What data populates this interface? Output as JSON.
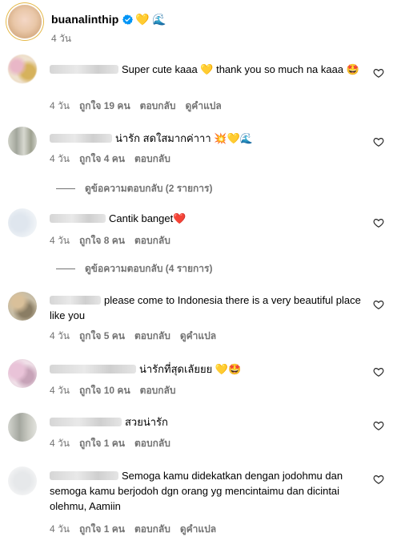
{
  "post": {
    "username": "buanalinthip",
    "emoji_1": "💛",
    "emoji_2": "🌊",
    "time": "4 วัน"
  },
  "labels": {
    "likes_prefix": "ถูกใจ",
    "likes_suffix": "คน",
    "reply": "ตอบกลับ",
    "translate": "ดูคำแปล"
  },
  "comments": [
    {
      "text": "Super cute kaaa 💛 thank you so much na kaaa 🤩",
      "time": "4 วัน",
      "likes": "19",
      "translate": true
    },
    {
      "text": "น่ารัก สดใสมากค่าาา 💥💛🌊",
      "time": "4 วัน",
      "likes": "4",
      "translate": false,
      "view_replies": "ดูข้อความตอบกลับ (2 รายการ)"
    },
    {
      "text": "Cantik banget❤️",
      "time": "4 วัน",
      "likes": "8",
      "translate": false,
      "view_replies": "ดูข้อความตอบกลับ (4 รายการ)"
    },
    {
      "text": "please come to Indonesia there is a very beautiful place like you",
      "time": "4 วัน",
      "likes": "5",
      "translate": true
    },
    {
      "text": "น่ารักที่สุดเลัยยย 💛🤩",
      "time": "4 วัน",
      "likes": "10",
      "translate": false
    },
    {
      "text": "สวยน่ารัก",
      "time": "4 วัน",
      "likes": "1",
      "translate": false
    },
    {
      "text": "Semoga kamu didekatkan dengan jodohmu dan semoga kamu berjodoh dgn orang yg mencintaimu dan dicintai olehmu, Aamiin",
      "time": "4 วัน",
      "likes": "1",
      "translate": true
    }
  ],
  "colors": {
    "secondary_text": "#737373",
    "verified_blue": "#0095f6"
  }
}
